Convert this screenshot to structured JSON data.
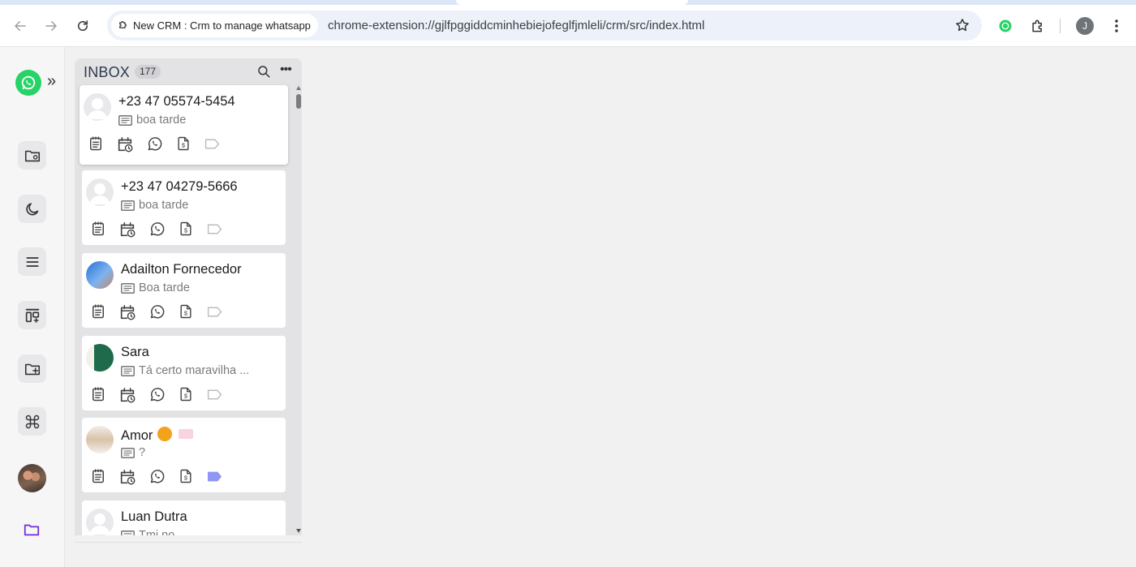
{
  "browser": {
    "tab_title": "New CRM : Crm to manage whatsapp",
    "url": "chrome-extension://gjlfpggiddcminhebiejofeglfjmleli/crm/src/index.html",
    "profile_initial": "J",
    "icons": [
      "back-icon",
      "forward-icon",
      "reload-icon",
      "extension-puzzle-icon",
      "star-icon",
      "whatsapp-extension-icon",
      "kebab-menu-icon"
    ]
  },
  "sidebar": {
    "expand_label": "»",
    "items": [
      "folder-settings-icon",
      "moon-icon",
      "menu-icon",
      "board-add-icon",
      "folder-add-icon",
      "command-icon"
    ],
    "accent_color": "#6b2fd6"
  },
  "inbox": {
    "title": "INBOX",
    "count": "177",
    "conversations": [
      {
        "name": "+23 47 05574-5454",
        "message": "boa tarde",
        "avatar": "default"
      },
      {
        "name": "+23 47 04279-5666",
        "message": "boa tarde",
        "avatar": "default"
      },
      {
        "name": "Adailton Fornecedor",
        "message": "Boa tarde",
        "avatar": "photo"
      },
      {
        "name": "Sara",
        "message": "Tá certo maravilha ...",
        "avatar": "photo"
      },
      {
        "name": "Amor",
        "message": "?",
        "avatar": "photo",
        "tag_color": "#8f97f5"
      },
      {
        "name": "Luan Dutra",
        "message": "Tmj no",
        "avatar": "default"
      }
    ],
    "action_icons": [
      "notes-icon",
      "schedule-icon",
      "whatsapp-icon",
      "invoice-icon",
      "tag-icon"
    ]
  },
  "colors": {
    "whatsapp_green": "#25d366",
    "tag_active": "#8f97f5"
  }
}
